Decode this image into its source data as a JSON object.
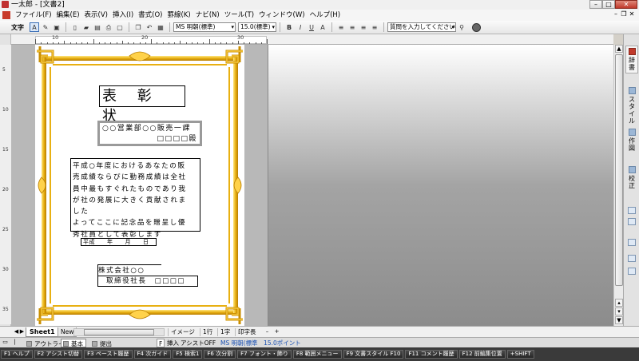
{
  "window": {
    "title": "一太郎 - [文書2]",
    "controls": {
      "minimize": "–",
      "maximize": "□",
      "close": "✕"
    }
  },
  "menu": {
    "items": [
      "ファイル(F)",
      "編集(E)",
      "表示(V)",
      "挿入(I)",
      "書式(O)",
      "罫線(K)",
      "ナビ(N)",
      "ツール(T)",
      "ウィンドウ(W)",
      "ヘルプ(H)"
    ]
  },
  "toolbar": {
    "mode_label": "文字",
    "font_name": "MS 明朝(標準)",
    "font_size": "15.0(標準)",
    "bold": "B",
    "italic": "I",
    "underline": "U",
    "help_query": "質問を入力してください"
  },
  "ruler": {
    "labels": [
      "10",
      "20",
      "30"
    ]
  },
  "vruler": {
    "labels": [
      "5",
      "10",
      "15",
      "20",
      "25",
      "30",
      "35"
    ]
  },
  "certificate": {
    "title": "表 彰 状",
    "recipient_line1": "○○営業部○○販売一課",
    "recipient_line2": "□□□□殿",
    "body_lines": [
      "平成○年度におけるあなたの販",
      "売成績ならびに勤務成績は全社",
      "員中最もすぐれたものであり我",
      "が社の発展に大きく貢献されま",
      "した",
      "よってここに記念品を贈呈し優",
      "秀社員として表彰します"
    ],
    "date": "平成　　年　　月　　日",
    "company": "株式会社○○",
    "representative": "取締役社長　□□□□"
  },
  "taskpane": {
    "tabs": [
      "辞書",
      "スタイル",
      "作図",
      "校正"
    ]
  },
  "sheetbar": {
    "sheet_name": "Sheet1",
    "new_tab": "New",
    "image_label": "イメージ",
    "row": "1行",
    "column": "1字",
    "print_length": "印字長"
  },
  "viewbar": {
    "tabs": [
      "アウトライン",
      "基本",
      "提出"
    ],
    "mode": "挿入",
    "assist": "アシストOFF",
    "font_info": "MS 明朝(標準　15.0ポイント",
    "f_label": "F"
  },
  "fkeys": [
    "F1 ヘルプ",
    "F2 アシスト切替",
    "F3 ペースト履歴",
    "F4 次ガイド",
    "F5 検索1",
    "F6 次分割",
    "F7 フォント・飾り",
    "F8 範囲メニュー",
    "F9 文書スタイル F10",
    "F11 コメント履歴",
    "F12 前編集位置",
    "+SHIFT"
  ],
  "colors": {
    "frame_gold": "#e8b012",
    "frame_light": "#ffdf5a",
    "frame_dark": "#b87c00",
    "fkey_bar": "#3a3a3a"
  }
}
